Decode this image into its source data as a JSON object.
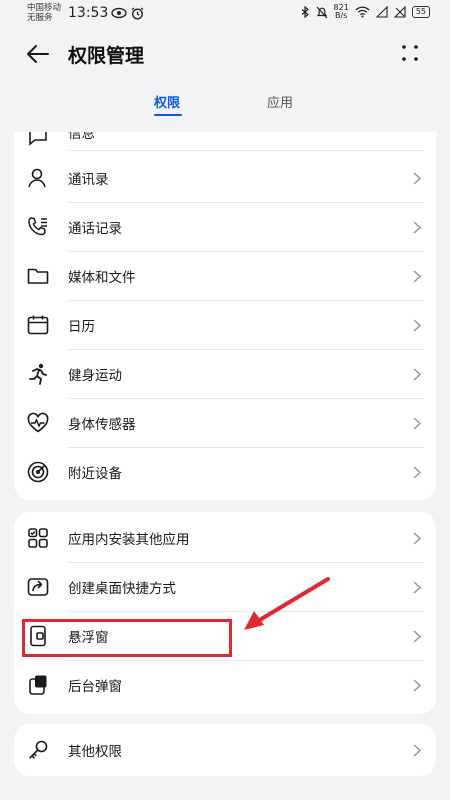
{
  "status_bar": {
    "carrier_line1": "中国移动",
    "carrier_line2": "无服务",
    "time": "13:53",
    "net_speed_value": "821",
    "net_speed_unit": "B/s",
    "battery": "55"
  },
  "header": {
    "title": "权限管理"
  },
  "tabs": [
    {
      "label": "权限",
      "active": true
    },
    {
      "label": "应用",
      "active": false
    }
  ],
  "group1": {
    "partial_item": "信息",
    "items": [
      {
        "label": "通讯录",
        "icon": "contacts-icon"
      },
      {
        "label": "通话记录",
        "icon": "call-log-icon"
      },
      {
        "label": "媒体和文件",
        "icon": "folder-icon"
      },
      {
        "label": "日历",
        "icon": "calendar-icon"
      },
      {
        "label": "健身运动",
        "icon": "running-icon"
      },
      {
        "label": "身体传感器",
        "icon": "heart-rate-icon"
      },
      {
        "label": "附近设备",
        "icon": "nearby-devices-icon"
      }
    ]
  },
  "group2": {
    "items": [
      {
        "label": "应用内安装其他应用",
        "icon": "apps-grid-icon"
      },
      {
        "label": "创建桌面快捷方式",
        "icon": "shortcut-icon"
      },
      {
        "label": "悬浮窗",
        "icon": "floating-window-icon"
      },
      {
        "label": "后台弹窗",
        "icon": "background-popup-icon"
      }
    ]
  },
  "group3": {
    "items": [
      {
        "label": "其他权限",
        "icon": "key-icon"
      }
    ]
  },
  "colors": {
    "accent": "#0a59f7",
    "annotation_red": "#e3272f",
    "background": "#f1f3f5"
  }
}
